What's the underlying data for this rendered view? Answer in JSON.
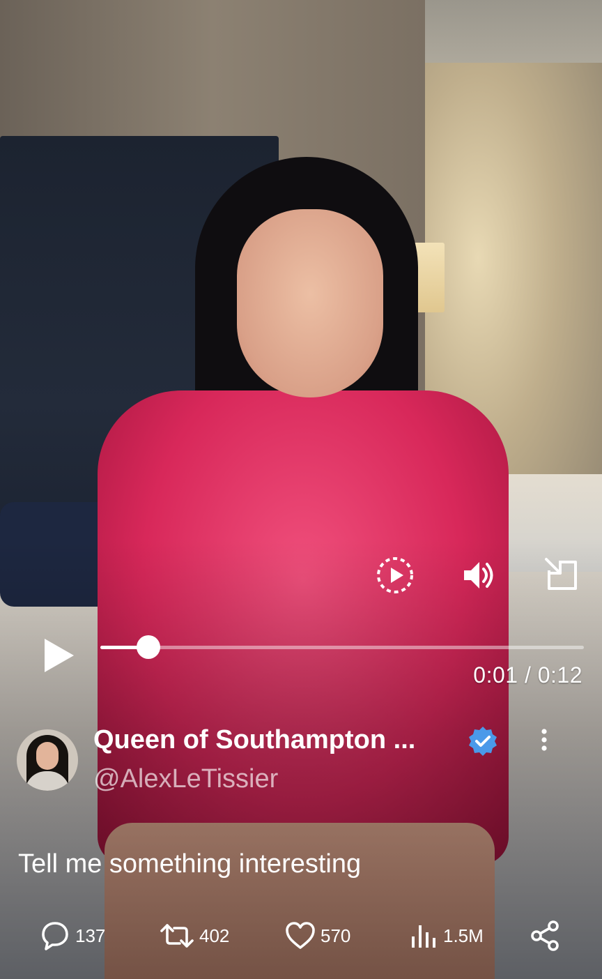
{
  "video": {
    "time_current": "0:01",
    "time_separator": " / ",
    "time_total": "0:12",
    "progress_fraction": 0.1
  },
  "author": {
    "display_name": "Queen of Southampton ...",
    "handle": "@AlexLeTissier",
    "verified": true
  },
  "tweet": {
    "text": "Tell me something interesting"
  },
  "actions": {
    "replies": "137",
    "reposts": "402",
    "likes": "570",
    "views": "1.5M"
  },
  "icons": {
    "play": "play-icon",
    "replay": "replay-icon",
    "volume": "volume-icon",
    "minimize": "minimize-icon",
    "verified": "verified-badge-icon",
    "more": "more-vertical-icon",
    "reply": "reply-icon",
    "repost": "repost-icon",
    "like": "heart-icon",
    "views": "views-icon",
    "share": "share-icon"
  },
  "colors": {
    "verified_blue": "#4a99e9",
    "foreground": "#ffffff"
  }
}
